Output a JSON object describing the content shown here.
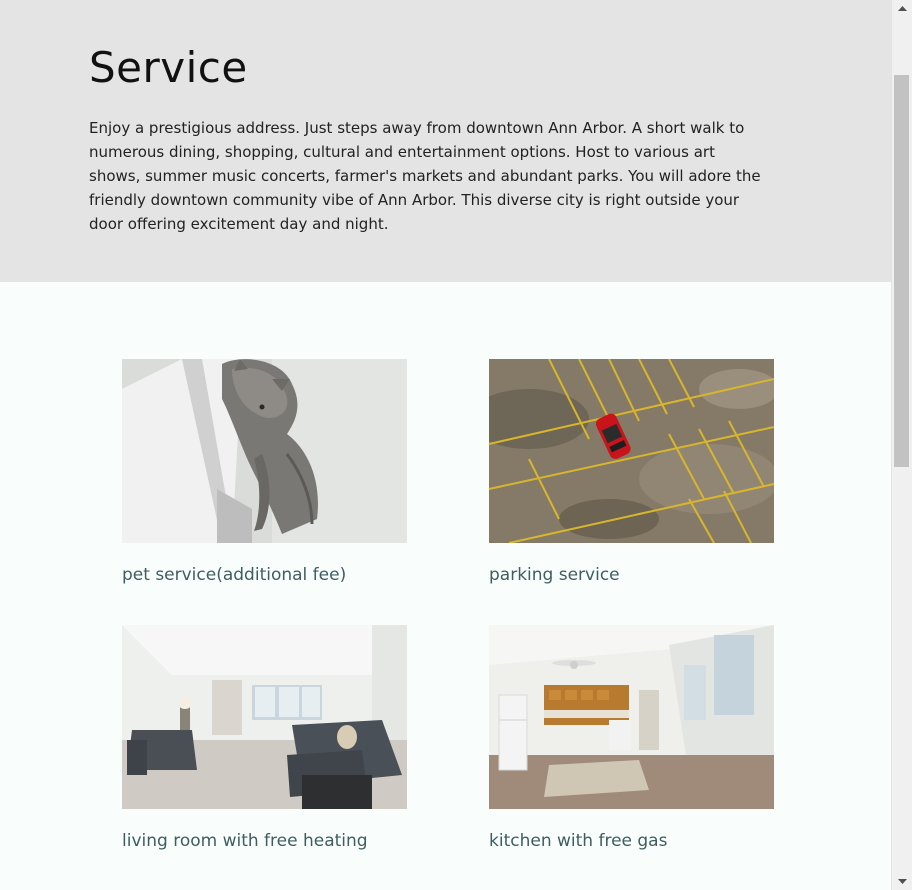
{
  "section": {
    "title": "Service",
    "description": "Enjoy a prestigious address. Just steps away from downtown Ann Arbor. A short walk to numerous dining, shopping, cultural and entertainment options. Host to various art shows, summer music concerts, farmer's markets and abundant parks. You will adore the friendly downtown community vibe of Ann Arbor. This diverse city is right outside your door offering excitement day and night."
  },
  "services": [
    {
      "caption": "pet service(additional fee)",
      "image_icon": "cat-photo"
    },
    {
      "caption": "parking service",
      "image_icon": "parking-lot-photo"
    },
    {
      "caption": "living room with free heating",
      "image_icon": "living-room-photo"
    },
    {
      "caption": "kitchen with free gas",
      "image_icon": "kitchen-photo"
    }
  ],
  "colors": {
    "hero_background": "#e4e4e4",
    "page_background": "#f9fefd",
    "caption_text": "#3e5e5e",
    "heading_text": "#111111"
  },
  "scrollbar": {
    "icon_up": "chevron-up-icon",
    "icon_down": "chevron-down-icon"
  }
}
